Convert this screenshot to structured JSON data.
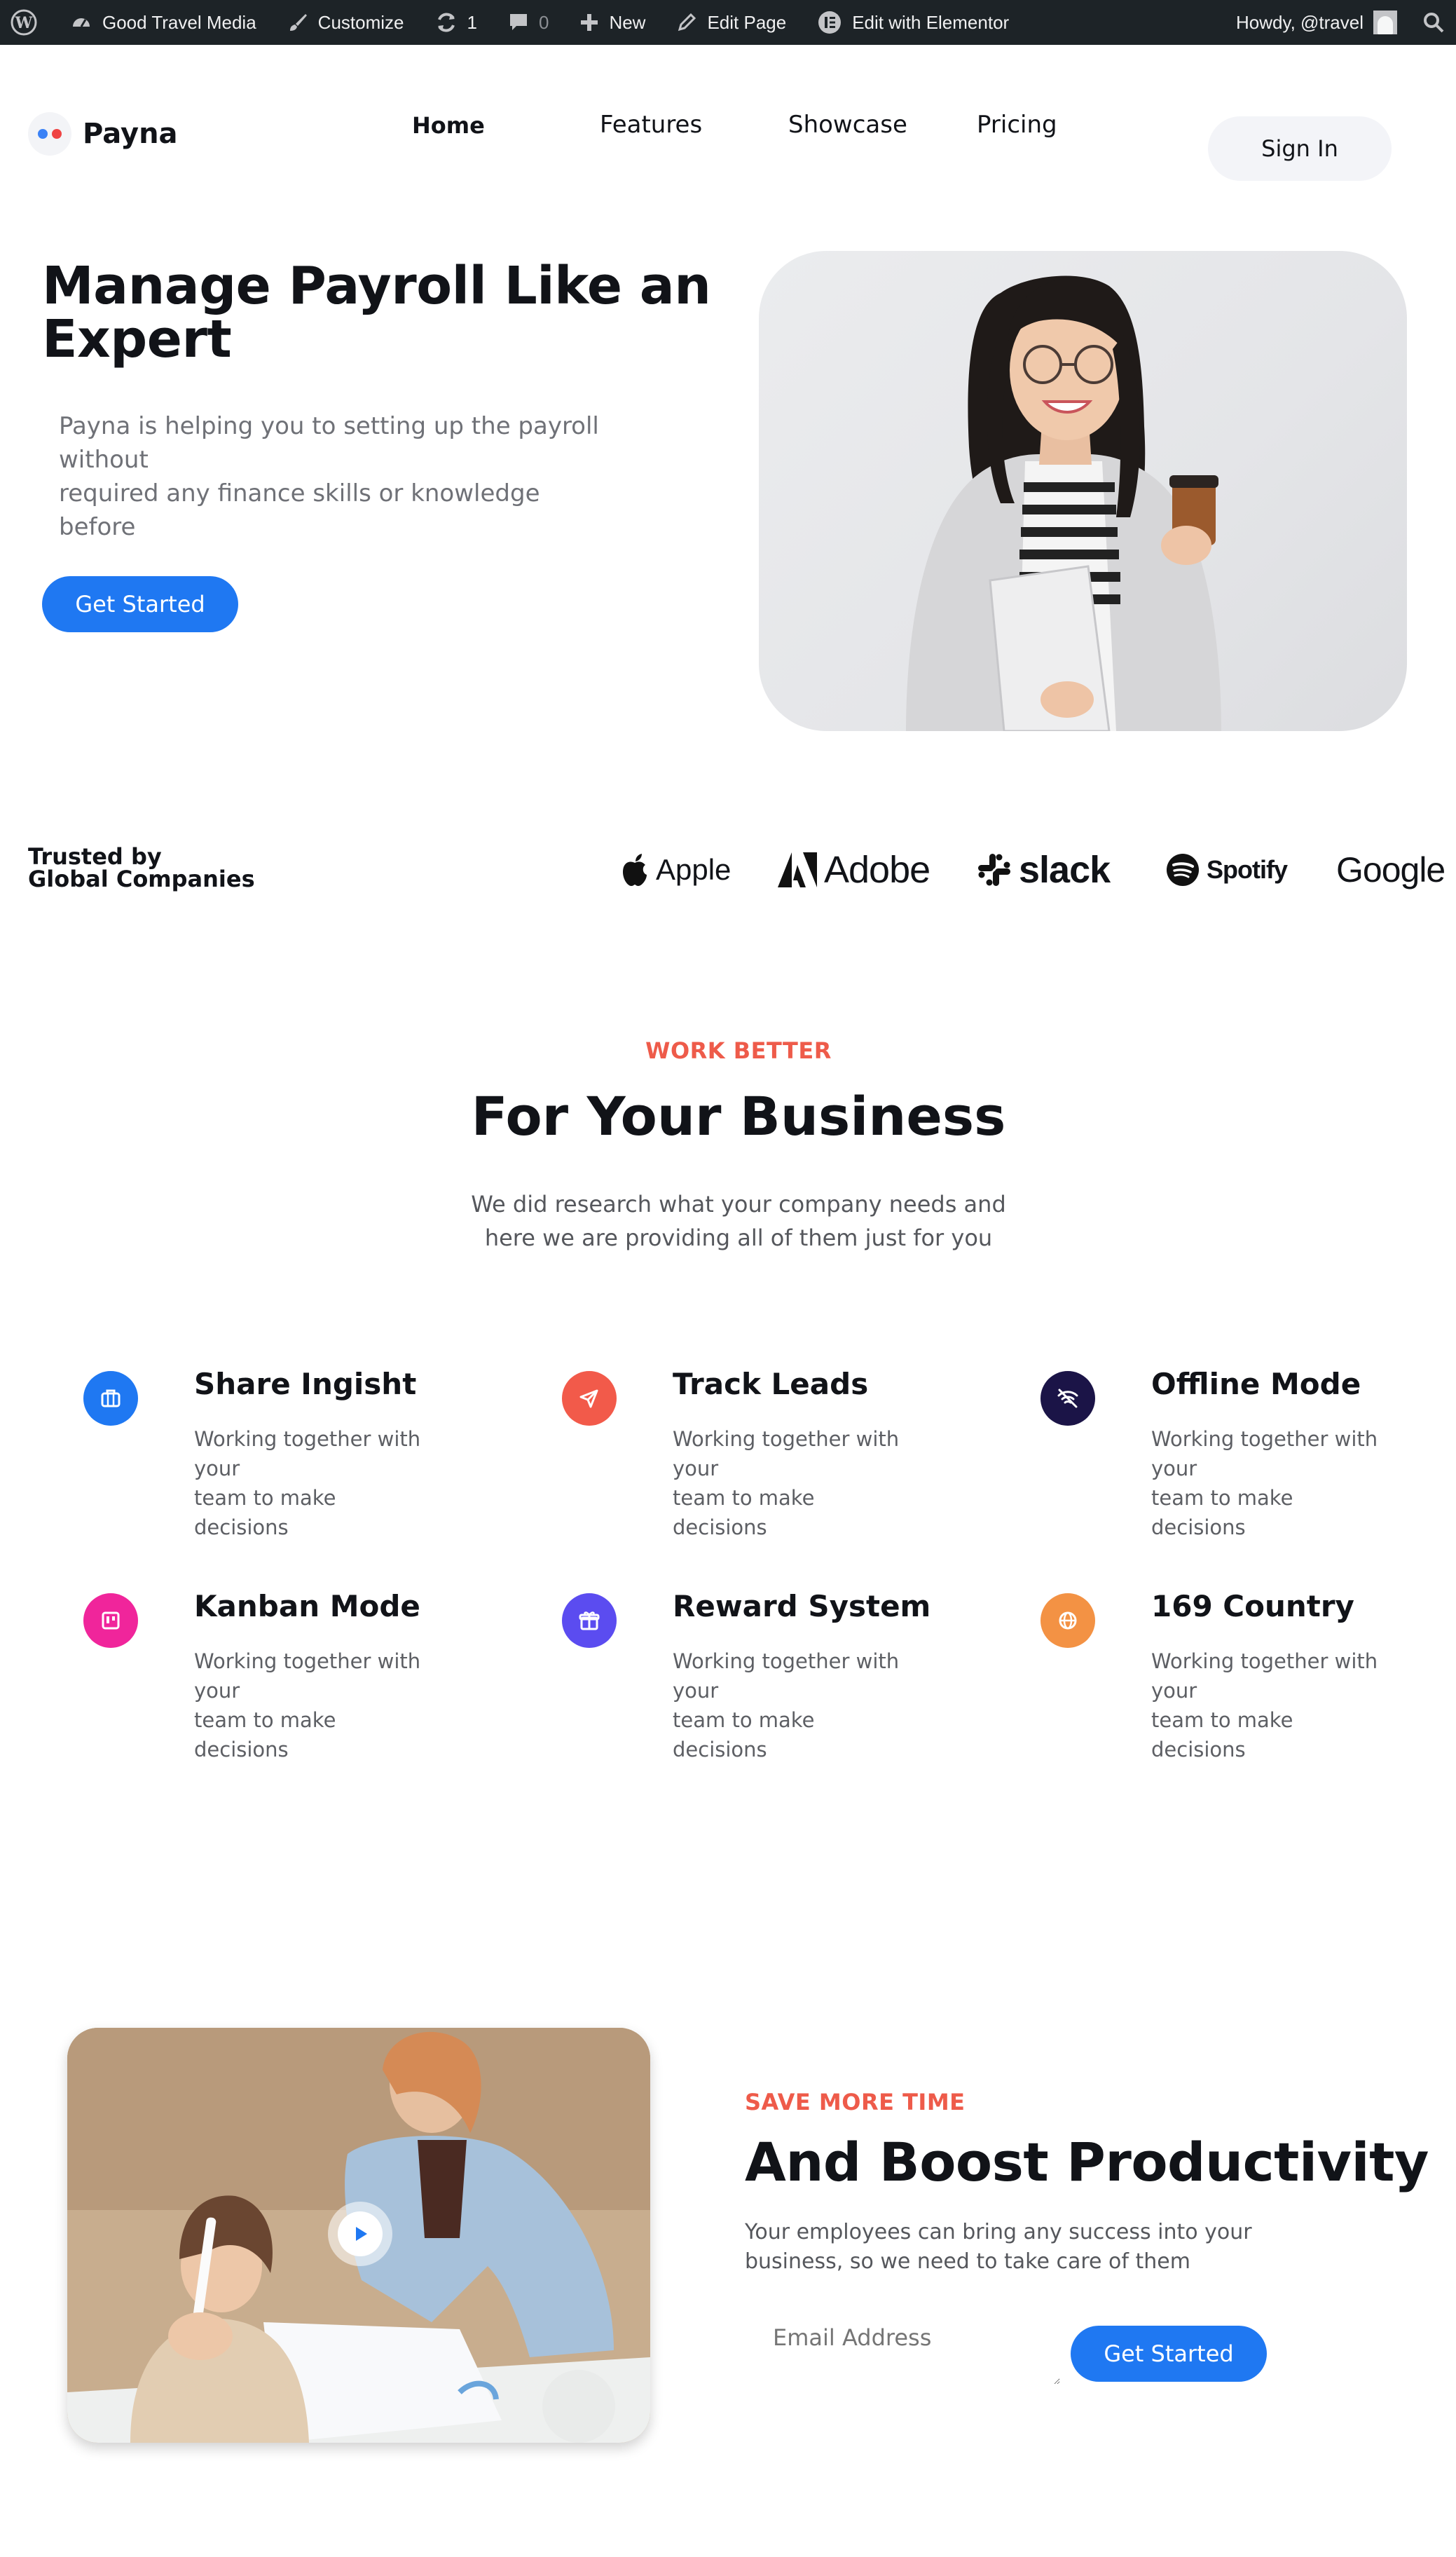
{
  "admin_bar": {
    "site_name": "Good Travel Media",
    "customize": "Customize",
    "updates_count": "1",
    "comments_count": "0",
    "new": "New",
    "edit_page": "Edit Page",
    "elementor": "Edit with Elementor",
    "howdy": "Howdy, @travel"
  },
  "header": {
    "logo_text": "Payna",
    "nav": [
      "Home",
      "Features",
      "Showcase",
      "Pricing"
    ],
    "sign_in": "Sign In"
  },
  "hero": {
    "title": "Manage Payroll Like an Expert",
    "desc_lines": [
      "Payna is helping you to setting up the payroll",
      "without",
      "required any finance skills or knowledge before"
    ],
    "cta": "Get Started"
  },
  "trusted": {
    "lines": [
      "Trusted by",
      "Global Companies"
    ],
    "brands": [
      "Apple",
      "Adobe",
      "slack",
      "Spotify",
      "Google"
    ]
  },
  "work_better": {
    "eyebrow": "WORK BETTER",
    "title": "For Your Business",
    "desc_lines": [
      "We did research what your company needs and",
      "here we are providing all of them just for you"
    ],
    "features": [
      {
        "title": "Share Ingisht",
        "desc_lines": [
          "Working together with",
          "your",
          "team to make",
          "decisions"
        ],
        "icon": "briefcase-icon",
        "color": "#1f78f2"
      },
      {
        "title": "Track Leads",
        "desc_lines": [
          "Working together with",
          "your",
          "team to make",
          "decisions"
        ],
        "icon": "send-icon",
        "color": "#f25a4a"
      },
      {
        "title": "Offline Mode",
        "desc_lines": [
          "Working together with",
          "your",
          "team to make",
          "decisions"
        ],
        "icon": "wifi-off-icon",
        "color": "#1b1447"
      },
      {
        "title": "Kanban Mode",
        "desc_lines": [
          "Working together with",
          "your",
          "team to make",
          "decisions"
        ],
        "icon": "kanban-icon",
        "color": "#f0259b"
      },
      {
        "title": "Reward System",
        "desc_lines": [
          "Working together with",
          "your",
          "team to make",
          "decisions"
        ],
        "icon": "gift-icon",
        "color": "#5b4cf0"
      },
      {
        "title": "169 Country",
        "desc_lines": [
          "Working together with",
          "your",
          "team to make",
          "decisions"
        ],
        "icon": "globe-icon",
        "color": "#f39244"
      }
    ]
  },
  "save_time": {
    "eyebrow": "SAVE MORE TIME",
    "title": "And Boost Productivity",
    "desc_lines": [
      "Your employees can bring any success into your",
      "business, so we need to take care of them"
    ],
    "email_placeholder": "Email Address",
    "cta": "Get Started"
  },
  "colors": {
    "primary": "#1f78f2",
    "accent": "#ee5b4a",
    "admin_bar": "#1d2327"
  }
}
